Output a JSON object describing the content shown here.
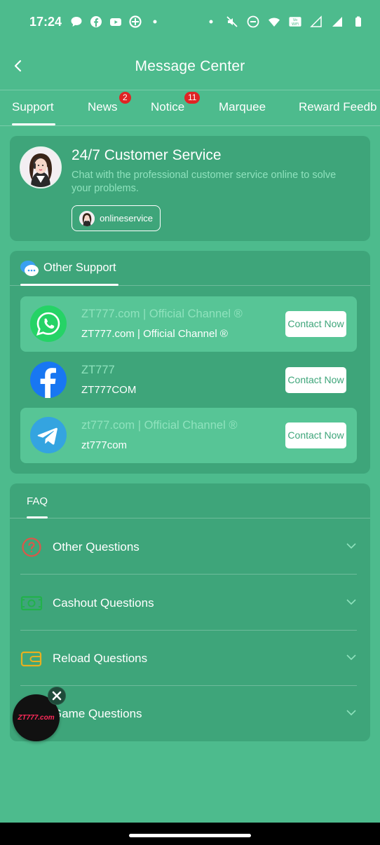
{
  "status_bar": {
    "time": "17:24",
    "left_icons": [
      "chat-bubble-icon",
      "facebook-icon",
      "youtube-icon",
      "pinwheel-icon",
      "dot-icon"
    ],
    "right_icons": [
      "dot-icon",
      "mute-icon",
      "dnd-icon",
      "wifi-icon",
      "vowifi-icon",
      "signal-icon",
      "signal-icon",
      "battery-icon"
    ],
    "vowifi_text": "Vo\nWiFi"
  },
  "header": {
    "title": "Message Center",
    "back_icon": "chevron-left-icon"
  },
  "tabs": [
    {
      "label": "Support",
      "active": true
    },
    {
      "label": "News",
      "badge": "2"
    },
    {
      "label": "Notice",
      "badge": "11"
    },
    {
      "label": "Marquee"
    },
    {
      "label": "Reward Feedb"
    }
  ],
  "customer_service": {
    "title": "24/7 Customer Service",
    "description": "Chat with the professional customer service online to solve your problems.",
    "button_label": "onlineservice"
  },
  "other_support": {
    "title": "Other Support",
    "items": [
      {
        "icon": "whatsapp-icon",
        "line1": "ZT777.com | Official Channel ®",
        "line2": "ZT777.com | Official Channel ®",
        "button": "Contact Now"
      },
      {
        "icon": "facebook-icon",
        "line1": "ZT777",
        "line2": "ZT777COM",
        "button": "Contact Now"
      },
      {
        "icon": "telegram-icon",
        "line1": "zt777.com | Official Channel ®",
        "line2": "zt777com",
        "button": "Contact Now"
      }
    ]
  },
  "faq": {
    "title": "FAQ",
    "items": [
      {
        "label": "Other Questions",
        "icon": "question-circle-icon"
      },
      {
        "label": "Cashout Questions",
        "icon": "cash-icon"
      },
      {
        "label": "Reload Questions",
        "icon": "wallet-icon"
      },
      {
        "label": "Game Questions",
        "icon": "game-icon"
      }
    ]
  },
  "floating": {
    "logo_text": "ZT777.com",
    "close_icon": "close-icon"
  },
  "colors": {
    "background": "#4dbb8d",
    "card": "#3ea57a",
    "highlight": "#57c596",
    "muted_text": "#8fe2bd",
    "badge": "#e02424"
  }
}
